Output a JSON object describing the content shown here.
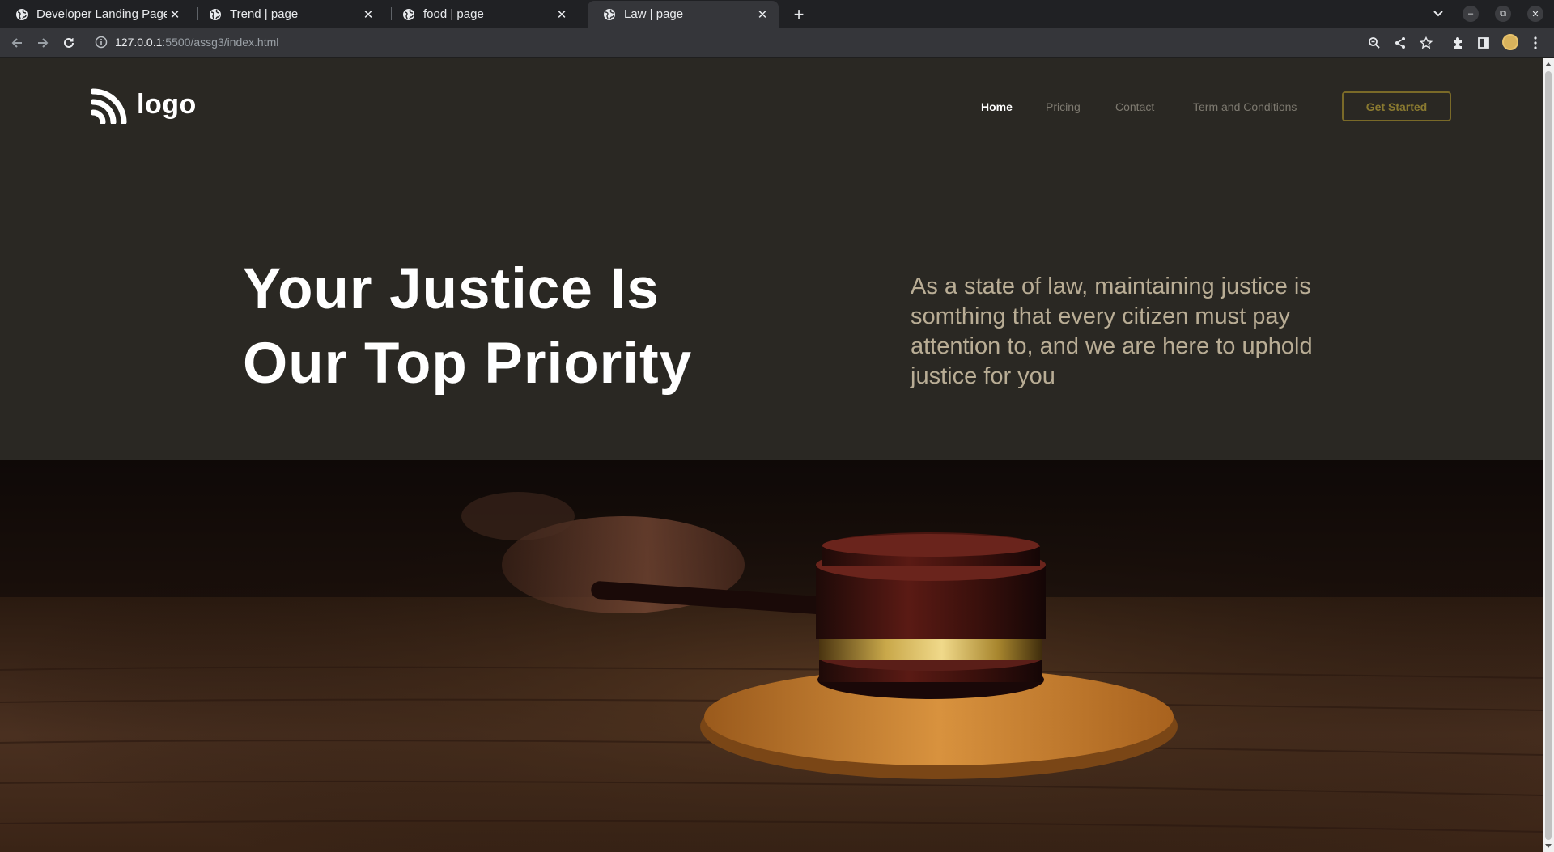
{
  "browser": {
    "tabs": [
      {
        "title": "Developer Landing Page",
        "active": false
      },
      {
        "title": "Trend | page",
        "active": false
      },
      {
        "title": "food | page",
        "active": false
      },
      {
        "title": "Law | page",
        "active": true
      }
    ],
    "url_host": "127.0.0.1",
    "url_rest": ":5500/assg3/index.html",
    "icons": [
      "globe-icon",
      "close-icon",
      "plus-icon",
      "chevron-down-icon",
      "minimize-icon",
      "restore-icon",
      "close-window-icon",
      "back-arrow-icon",
      "forward-arrow-icon",
      "reload-icon",
      "info-icon",
      "zoom-icon",
      "share-icon",
      "star-icon",
      "extensions-icon",
      "side-panel-icon",
      "profile-avatar",
      "kebab-menu-icon"
    ]
  },
  "header": {
    "logo_text": "logo",
    "nav": [
      {
        "label": "Home",
        "active": true
      },
      {
        "label": "Pricing",
        "active": false
      },
      {
        "label": "Contact",
        "active": false
      },
      {
        "label": "Term and Conditions",
        "active": false
      }
    ],
    "cta_label": "Get Started"
  },
  "hero": {
    "title_line1": "Your Justice Is",
    "title_line2": "Our Top Priority",
    "description": "As a state of law, maintaining justice is somthing that every citizen must pay attention to, and we are here to uphold justice for you"
  },
  "colors": {
    "page_bg": "#2a2823",
    "accent": "#7a6a28",
    "desc_text": "#b9ad95",
    "nav_inactive": "#7e7a70"
  }
}
